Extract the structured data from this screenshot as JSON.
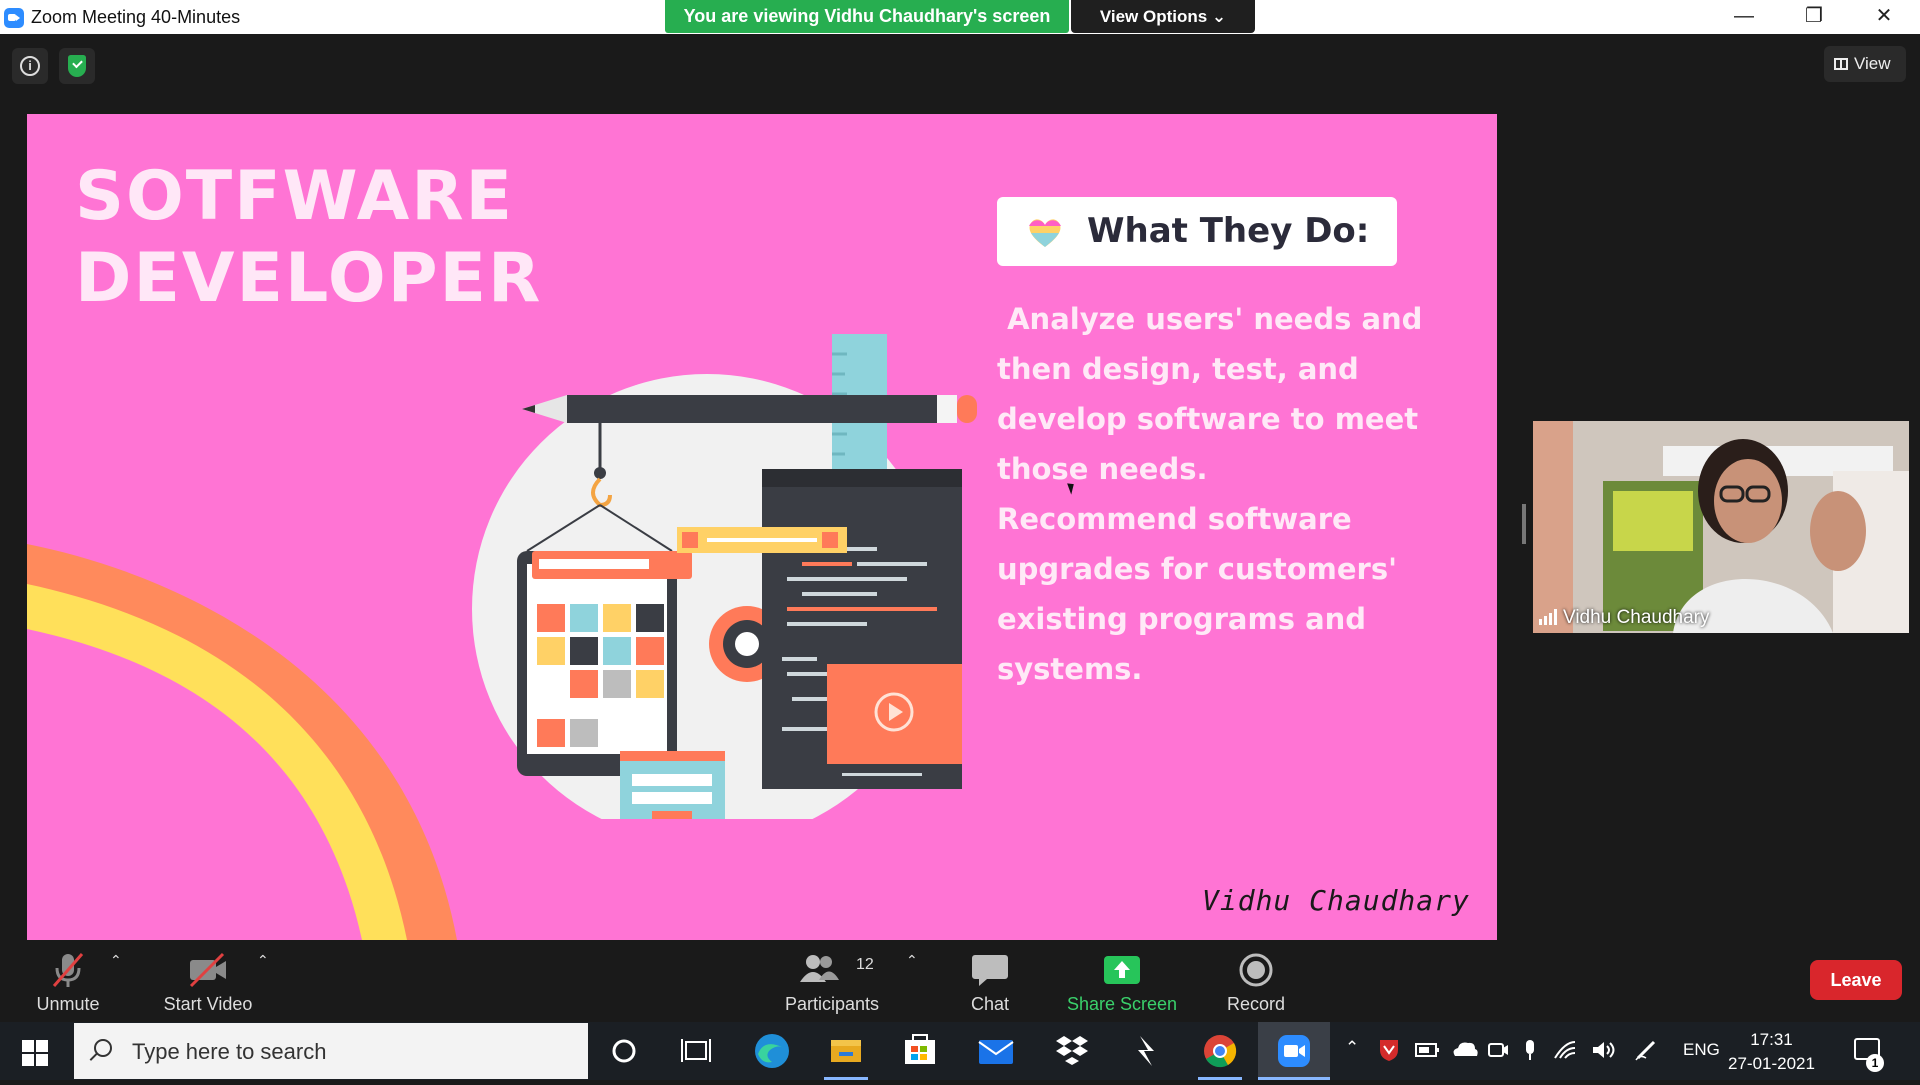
{
  "window": {
    "title": "Zoom Meeting 40-Minutes",
    "banner": "You are viewing Vidhu Chaudhary's screen",
    "view_options": "View Options",
    "controls": {
      "minimize": "—",
      "restore": "❐",
      "close": "✕"
    }
  },
  "top_controls": {
    "info": "i",
    "view": "View"
  },
  "slide": {
    "title_line1": "SOTFWARE",
    "title_line2": "DEVELOPER",
    "box_heading": "What They Do:",
    "body_line1": " Analyze users' needs and then design, test, and develop software to meet those needs.",
    "body_line2": "Recommend software upgrades for customers' existing programs and systems.",
    "signature": "Vidhu Chaudhary",
    "colors": {
      "background": "#ff74d4",
      "wave_orange": "#ff8a5c",
      "wave_yellow": "#ffe05a"
    }
  },
  "participant_video": {
    "name": "Vidhu Chaudhary"
  },
  "toolbar": {
    "unmute": "Unmute",
    "start_video": "Start Video",
    "participants": "Participants",
    "participants_count": "12",
    "chat": "Chat",
    "share_screen": "Share Screen",
    "record": "Record",
    "leave": "Leave"
  },
  "taskbar": {
    "search_placeholder": "Type here to search",
    "language": "ENG",
    "time": "17:31",
    "date": "27-01-2021",
    "notifications": "1",
    "apps": [
      "cortana-icon",
      "task-view-icon",
      "edge-icon",
      "file-explorer-icon",
      "store-icon",
      "mail-icon",
      "dropbox-icon",
      "app-icon",
      "chrome-icon",
      "zoom-icon"
    ]
  }
}
